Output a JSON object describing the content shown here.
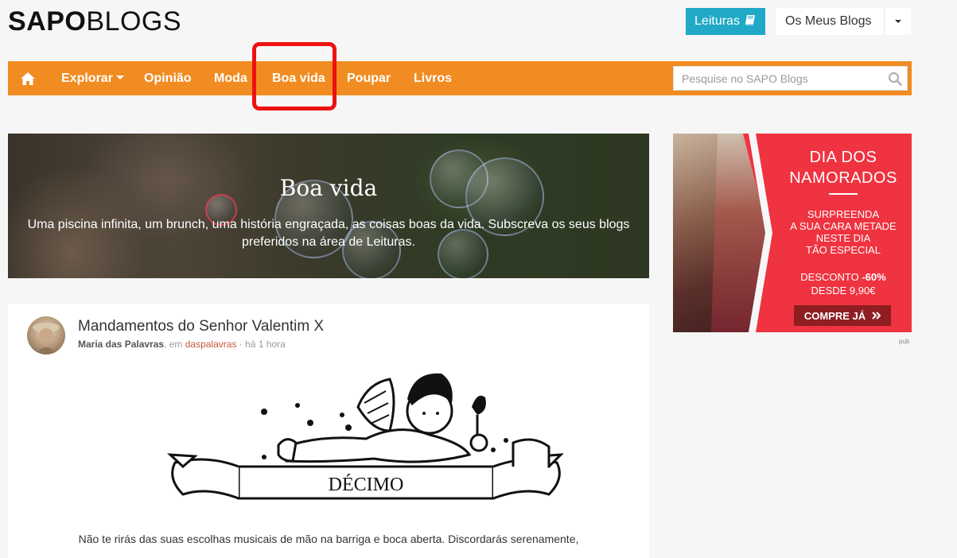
{
  "header": {
    "logo_strong": "SAPO",
    "logo_light": "BLOGS",
    "leituras_label": "Leituras",
    "meus_blogs_label": "Os Meus Blogs"
  },
  "nav": {
    "items": [
      {
        "label": "Explorar"
      },
      {
        "label": "Opinião"
      },
      {
        "label": "Moda"
      },
      {
        "label": "Boa vida",
        "highlighted": true
      },
      {
        "label": "Poupar"
      },
      {
        "label": "Livros"
      }
    ],
    "search_placeholder": "Pesquise no SAPO Blogs"
  },
  "hero": {
    "title": "Boa vida",
    "description": "Uma piscina infinita, um brunch, uma história engraçada, as coisas boas da vida. Subscreva os seus blogs preferidos na área de Leituras."
  },
  "ad": {
    "headline_1": "DIA DOS",
    "headline_2": "NAMORADOS",
    "line_1": "SURPREENDA",
    "line_2": "A SUA CARA METADE",
    "line_3": "NESTE DIA",
    "line_4": "TÃO ESPECIAL",
    "discount_label": "DESCONTO ",
    "discount_value": "-60%",
    "price_line": "DESDE 9,90€",
    "cta": "COMPRE JÁ",
    "pub_label": "pub"
  },
  "post": {
    "title": "Mandamentos do Senhor Valentim X",
    "author": "Maria das Palavras",
    "sep_in": ", em ",
    "blog": "daspalavras",
    "time": " · há 1 hora",
    "banner_text": "DÉCIMO",
    "excerpt": "Não te rirás das suas escolhas musicais de mão na barriga e boca aberta. Discordarás serenamente,"
  },
  "colors": {
    "nav_bg": "#f08c22",
    "leituras_bg": "#20a9c7",
    "ad_bg": "#ef3340",
    "highlight": "#ee1111",
    "blog_link": "#c7553b"
  },
  "icons": [
    "home-icon",
    "book-icon",
    "chevron-down-icon",
    "search-icon",
    "double-chevron-right-icon"
  ]
}
